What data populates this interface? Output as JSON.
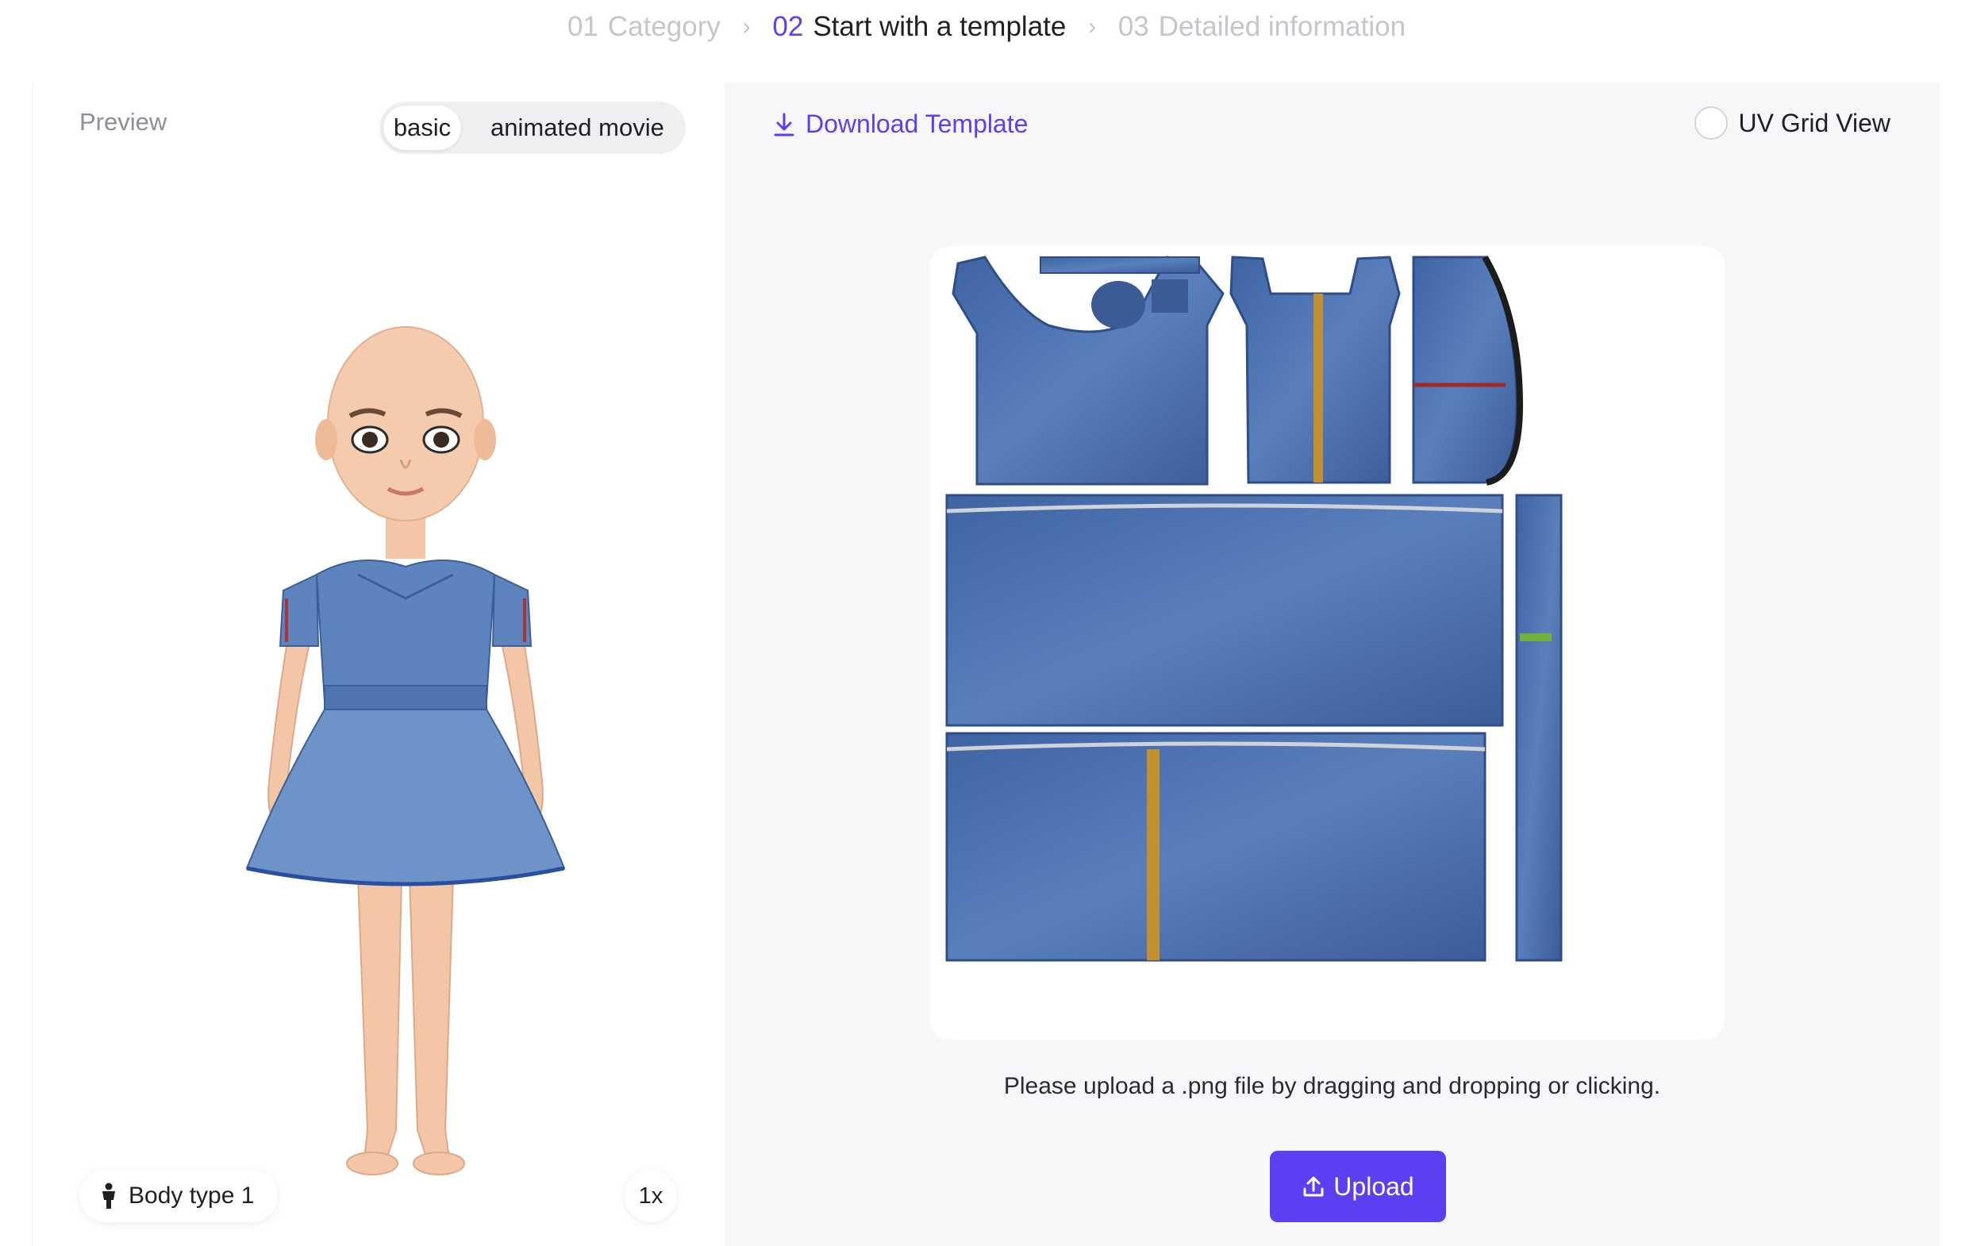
{
  "steps": [
    {
      "num": "01",
      "label": "Category",
      "state": "inactive"
    },
    {
      "num": "02",
      "label": "Start with a template",
      "state": "active"
    },
    {
      "num": "03",
      "label": "Detailed information",
      "state": "inactive"
    }
  ],
  "preview": {
    "title": "Preview",
    "mode_options": [
      "basic",
      "animated movie"
    ],
    "mode_selected": "basic",
    "body_type": "Body type 1",
    "zoom": "1x"
  },
  "editor": {
    "download_label": "Download Template",
    "uv_grid_label": "UV Grid View",
    "uv_grid_checked": false,
    "hint": "Please upload a .png file by dragging and dropping or clicking.",
    "upload_label": "Upload"
  },
  "colors": {
    "accent": "#5b3ff0",
    "denim": "#4a6da8",
    "skin": "#f2c6a6"
  },
  "icons": {
    "chevron": "chevron-right-icon",
    "download": "download-icon",
    "upload": "upload-icon",
    "body": "person-icon"
  }
}
